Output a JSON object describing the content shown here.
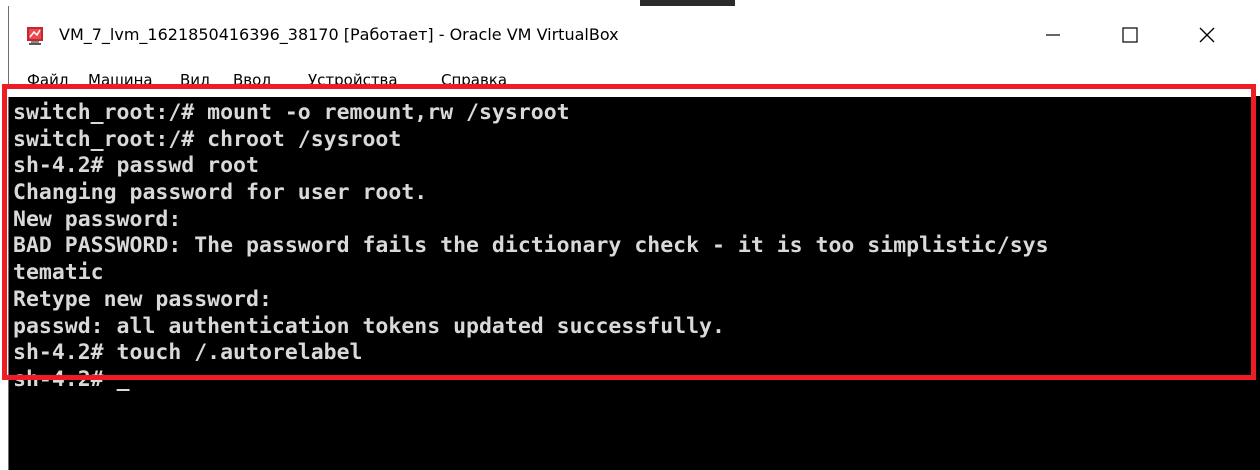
{
  "window": {
    "title": "VM_7_lvm_1621850416396_38170 [Работает] - Oracle VM VirtualBox",
    "app_icon": "virtualbox-icon",
    "buttons": {
      "minimize_icon": "minimize-icon",
      "maximize_icon": "maximize-icon",
      "close_icon": "close-icon"
    }
  },
  "menu": {
    "items": [
      "Файл",
      "Машина",
      "Вид",
      "Ввод",
      "Устройства",
      "Справка"
    ]
  },
  "console": {
    "lines": [
      "switch_root:/# mount -o remount,rw /sysroot",
      "switch_root:/# chroot /sysroot",
      "sh-4.2# passwd root",
      "Changing password for user root.",
      "New password:",
      "BAD PASSWORD: The password fails the dictionary check - it is too simplistic/sys",
      "tematic",
      "Retype new password:",
      "passwd: all authentication tokens updated successfully.",
      "sh-4.2# touch /.autorelabel",
      "sh-4.2# "
    ],
    "cursor": "_"
  },
  "colors": {
    "highlight": "#ee1c25",
    "console_bg": "#000000",
    "console_fg": "#d9d9d9"
  }
}
